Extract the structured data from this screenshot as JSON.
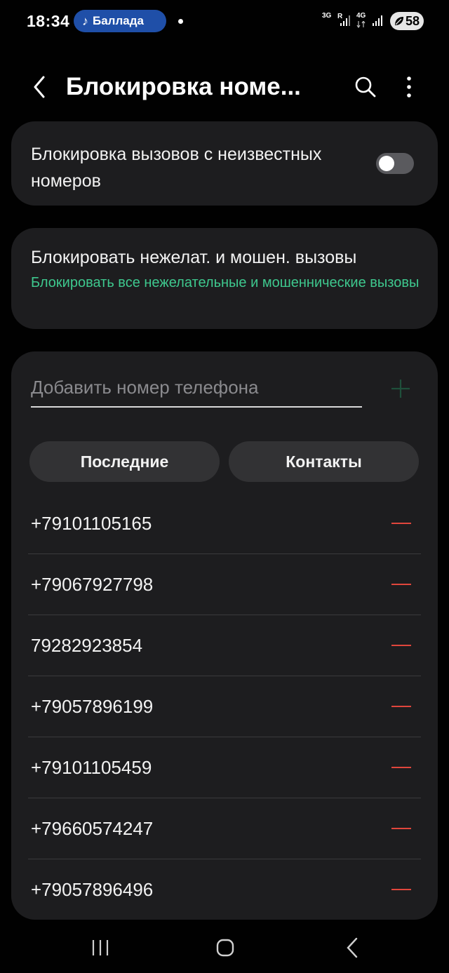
{
  "status_bar": {
    "time": "18:34",
    "media_label": "Баллада",
    "net1": "3G",
    "roaming": "R",
    "net2": "4G",
    "battery": "58"
  },
  "app_bar": {
    "title": "Блокировка номе..."
  },
  "unknown_block": {
    "label": "Блокировка вызовов с неизвестных номеров",
    "enabled": false
  },
  "spam_block": {
    "title": "Блокировать нежелат. и мошен. вызовы",
    "subtitle": "Блокировать все нежелательные и мошеннические вызовы"
  },
  "add_number": {
    "placeholder": "Добавить номер телефона"
  },
  "tabs": {
    "recent": "Последние",
    "contacts": "Контакты"
  },
  "blocked_numbers": [
    "+79101105165",
    "+79067927798",
    "79282923854",
    "+79057896199",
    "+79101105459",
    "+79660574247",
    "+79057896496"
  ],
  "colors": {
    "accent_green": "#3ec88e",
    "remove_red": "#e0463c",
    "media_pill": "#1f4fa8"
  }
}
